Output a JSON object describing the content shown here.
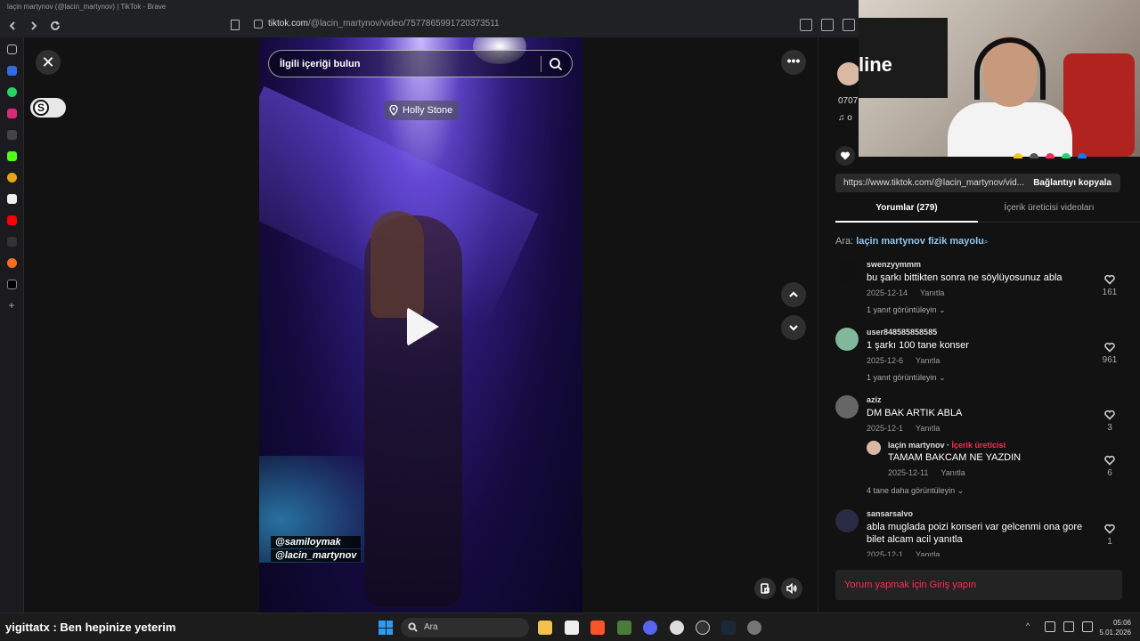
{
  "window": {
    "title": "laçin martynov (@lacin_martynov) | TikTok - Brave"
  },
  "address_bar": {
    "domain": "tiktok.com",
    "path": "/@lacin_martynov/video/7577865991720373511"
  },
  "video": {
    "search_placeholder": "İlgili içeriği bulun",
    "location": "Holly Stone",
    "tags": [
      "@samiloymak",
      "@lacin_martynov"
    ]
  },
  "panel": {
    "link_url": "https://www.tiktok.com/@lacin_martynov/vid...",
    "copy_link_label": "Bağlantıyı kopyala",
    "tabs": [
      {
        "label": "Yorumlar (279)",
        "active": true
      },
      {
        "label": "İçerik üreticisi videoları",
        "active": false
      }
    ],
    "related_prefix": "Ara:",
    "related_query": "laçin martynov fizik mayolu",
    "reply_label": "Yanıtla",
    "creator_label": "İçerik üreticisi",
    "comments": [
      {
        "user": "swenzyymmm",
        "text": "bu şarkı bittikten sonra ne söylüyosunuz abla",
        "date": "2025-12-14",
        "likes": "161",
        "replies": "1 yanıt görüntüleyin"
      },
      {
        "user": "user848585858585",
        "text": "1 şarkı 100 tane konser",
        "date": "2025-12-6",
        "likes": "961",
        "replies": "1 yanıt görüntüleyin"
      },
      {
        "user": "aziz",
        "text": "DM BAK ARTIK ABLA",
        "date": "2025-12-1",
        "likes": "3",
        "replies": "4 tane daha görüntüleyin"
      },
      {
        "user": "sansarsalvo",
        "text": "abla muglada poizi konseri var gelcenmi ona gore bilet alcam acil yanıtla",
        "date": "2025-12-1",
        "likes": "1",
        "replies": ""
      }
    ],
    "creator_reply": {
      "user": "laçin martynov",
      "text": "TAMAM BAKCAM NE YAZDIN",
      "date": "2025-12-11",
      "likes": "6"
    },
    "login_prompt": "Yorum yapmak için Giriş yapın"
  },
  "webcam": {
    "profile_partial": "0707",
    "music_partial": "o"
  },
  "taskbar": {
    "overlay_text": "yigittatx : Ben hepinize yeterim",
    "search_label": "Ara",
    "time": "05:06",
    "date": "5.01.2026"
  },
  "colors": {
    "accent_pink": "#fe2c55",
    "link_blue": "#8ec6f0"
  }
}
